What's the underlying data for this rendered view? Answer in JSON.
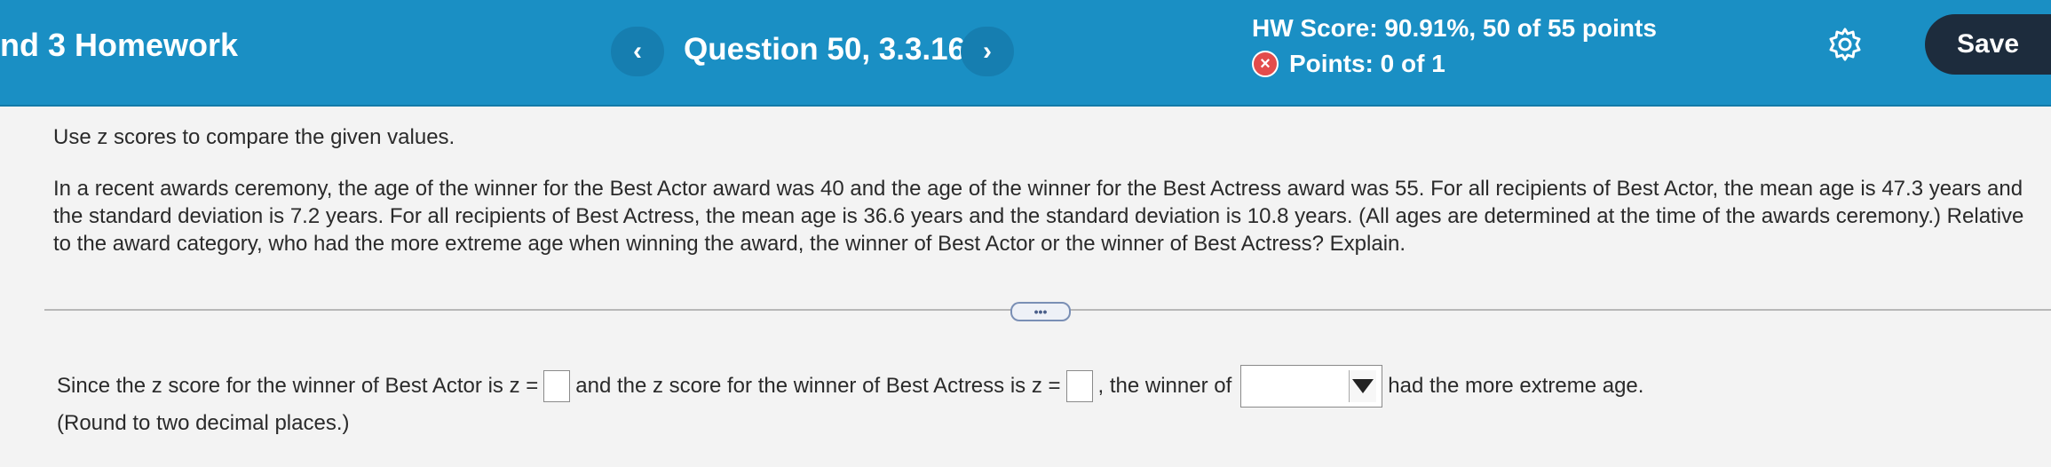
{
  "header": {
    "course_title": "nd 3 Homework",
    "prev_icon": "‹",
    "next_icon": "›",
    "question": "Question 50, 3.3.16",
    "hw_score": "HW Score: 90.91%, 50 of 55 points",
    "points": "Points: 0 of 1",
    "points_icon": "×",
    "save_label": "Save",
    "colors": {
      "bar": "#1a8fc4",
      "save": "#1d2c3d",
      "error": "#e34c4c"
    }
  },
  "problem": {
    "instruction": "Use z scores to compare the given values.",
    "text": "In a recent awards ceremony, the age of the winner for the Best Actor award was 40 and the age of the winner for the Best Actress award was 55. For all recipients of Best Actor, the mean age is 47.3 years and the standard deviation is 7.2 years. For all recipients of Best Actress, the mean age is 36.6 years and the standard deviation is 10.8 years. (All ages are determined at the time of the awards ceremony.) Relative to the award category, who had the more extreme age when winning the award, the winner of Best Actor or the winner of Best Actress? Explain.",
    "more_label": "•••"
  },
  "answer": {
    "part1": "Since the z score for the winner of Best Actor is z =",
    "part2": "and the z score for the winner of Best Actress is z =",
    "part3": ", the winner of",
    "part4": "had the more extreme age.",
    "actor_z_value": "",
    "actress_z_value": "",
    "winner_selected": "",
    "round_note": "(Round to two decimal places.)"
  }
}
